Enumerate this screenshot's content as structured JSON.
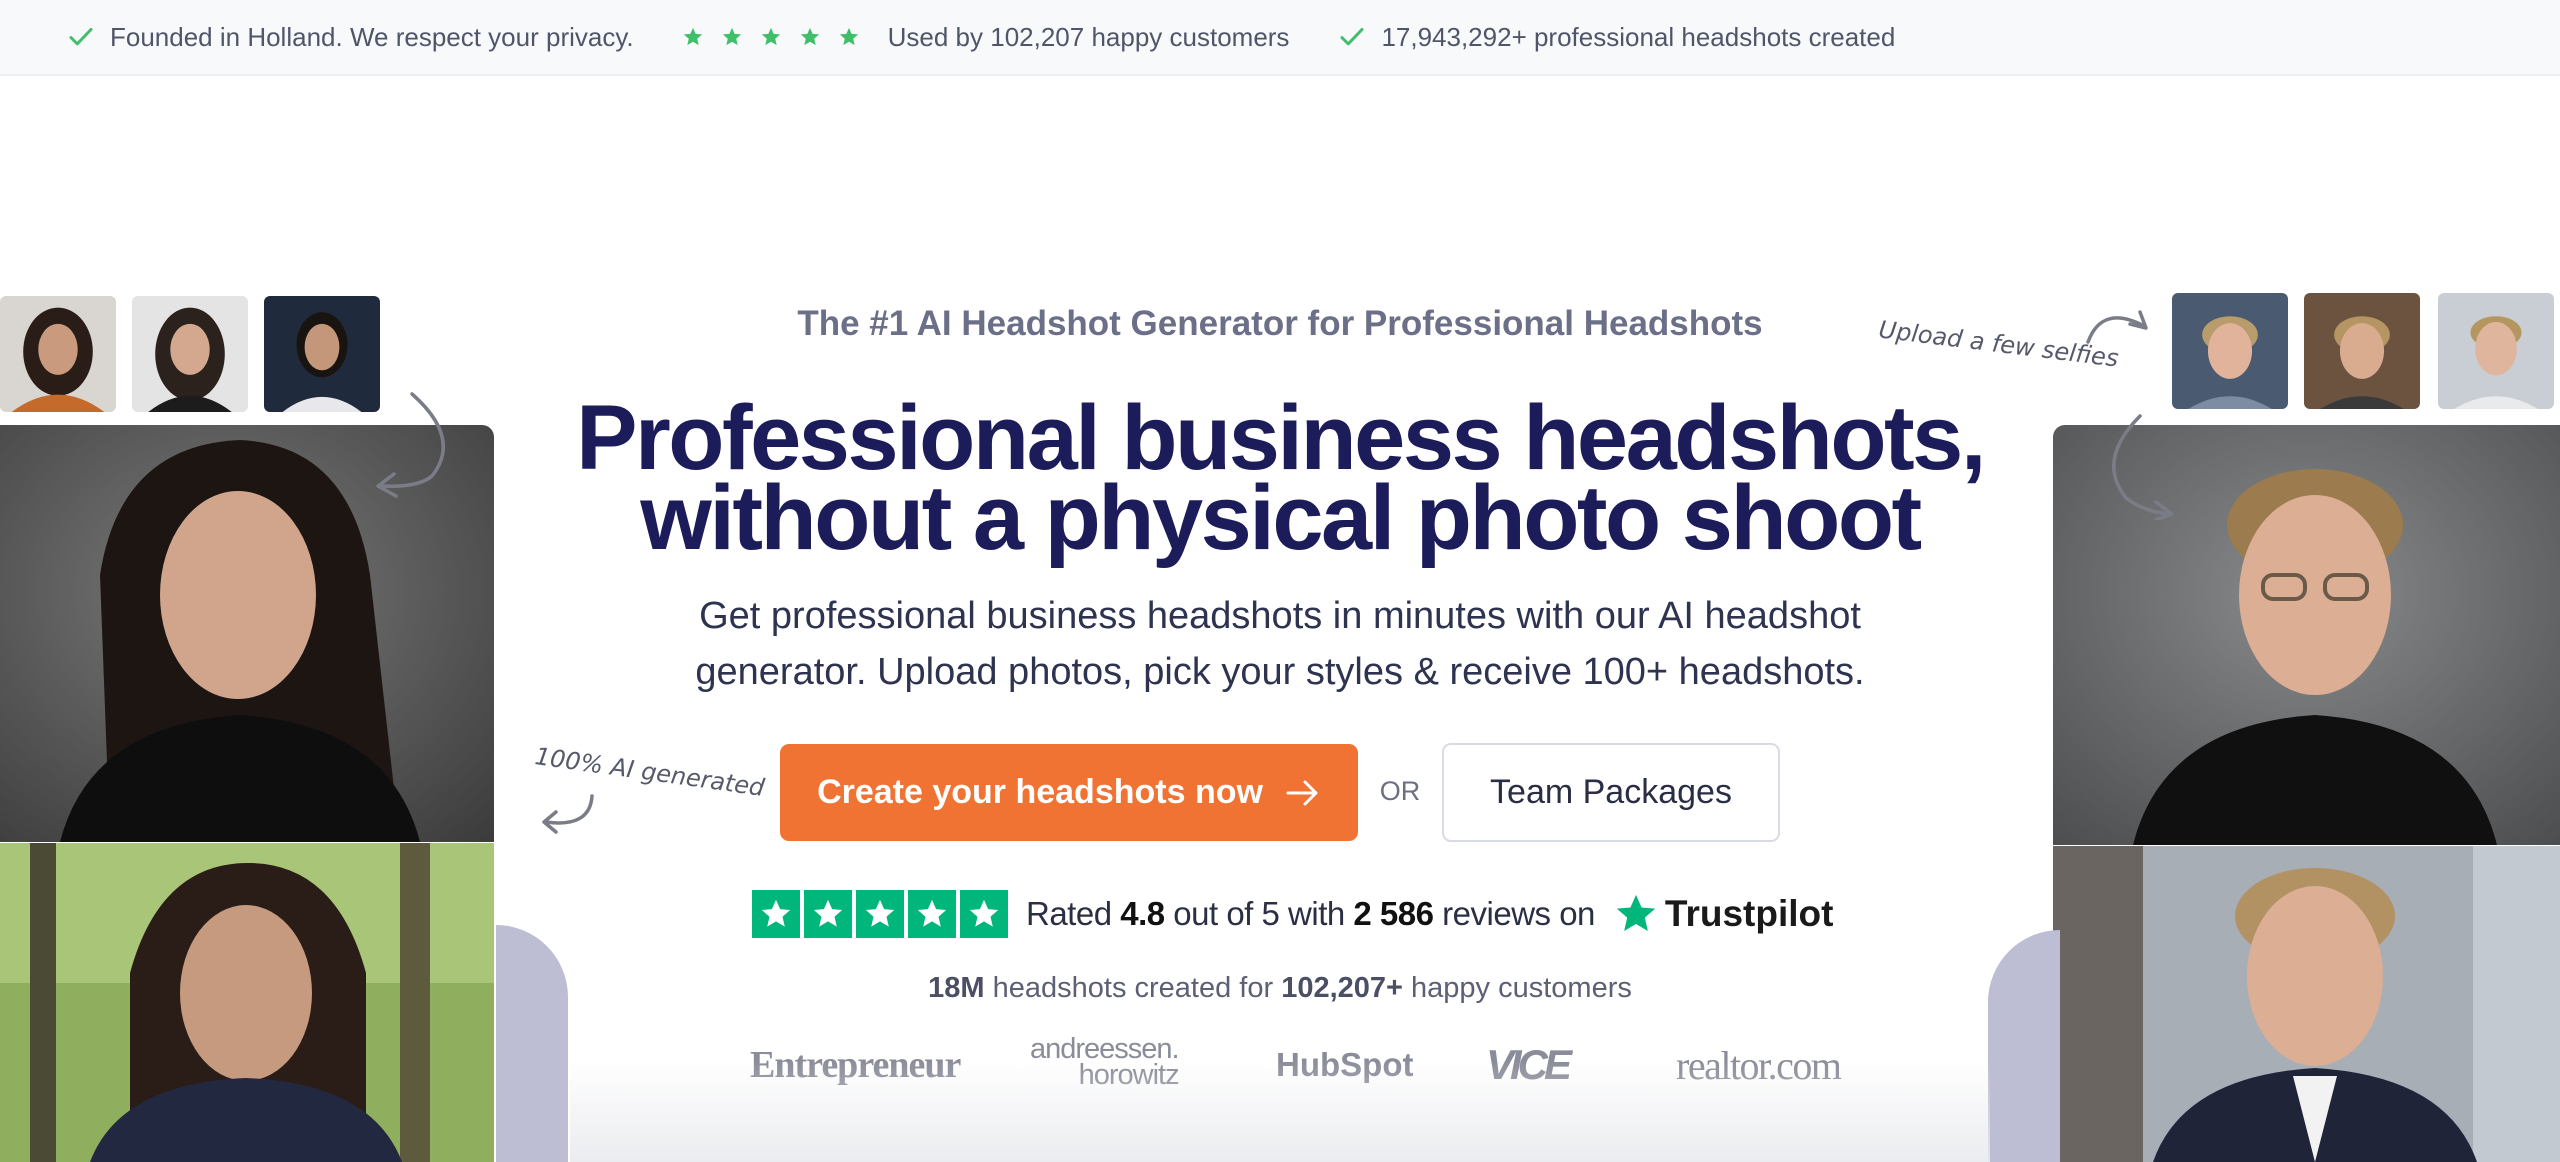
{
  "topbar": {
    "items": [
      {
        "icon": "check-icon",
        "text": "Founded in Holland. We respect your privacy."
      },
      {
        "icon": "five-stars-icon",
        "text": "Used by 102,207 happy customers"
      },
      {
        "icon": "check-icon",
        "text": "17,943,292+ professional headshots created"
      }
    ]
  },
  "hero": {
    "eyebrow": "The #1 AI Headshot Generator for Professional Headshots",
    "headline_line1": "Professional business headshots,",
    "headline_line2": "without a physical photo shoot",
    "sub_line1": "Get professional business headshots in minutes with our AI headshot",
    "sub_line2": "generator. Upload photos, pick your styles & receive 100+ headshots."
  },
  "notes": {
    "ai_generated": "100% AI generated",
    "upload": "Upload a few selfies"
  },
  "cta": {
    "primary_label": "Create your headshots now",
    "or_label": "OR",
    "secondary_label": "Team Packages"
  },
  "rating": {
    "prefix": "Rated",
    "score": "4.8",
    "middle": "out of 5 with",
    "count": "2 586",
    "suffix": "reviews on",
    "brand": "Trustpilot"
  },
  "stat": {
    "amount": "18M",
    "text1": "headshots created for",
    "customers": "102,207+",
    "text2": "happy customers"
  },
  "press": {
    "entrepreneur": "Entrepreneur",
    "a16z_line1": "andreessen.",
    "a16z_line2": "horowitz",
    "hubspot": "HubSpot",
    "vice": "VICE",
    "realtor": "realtor.com"
  },
  "colors": {
    "accent": "#f07333",
    "headline": "#1c1c5a",
    "trustpilot_green": "#00b67a",
    "check_green": "#3fbf6a"
  }
}
